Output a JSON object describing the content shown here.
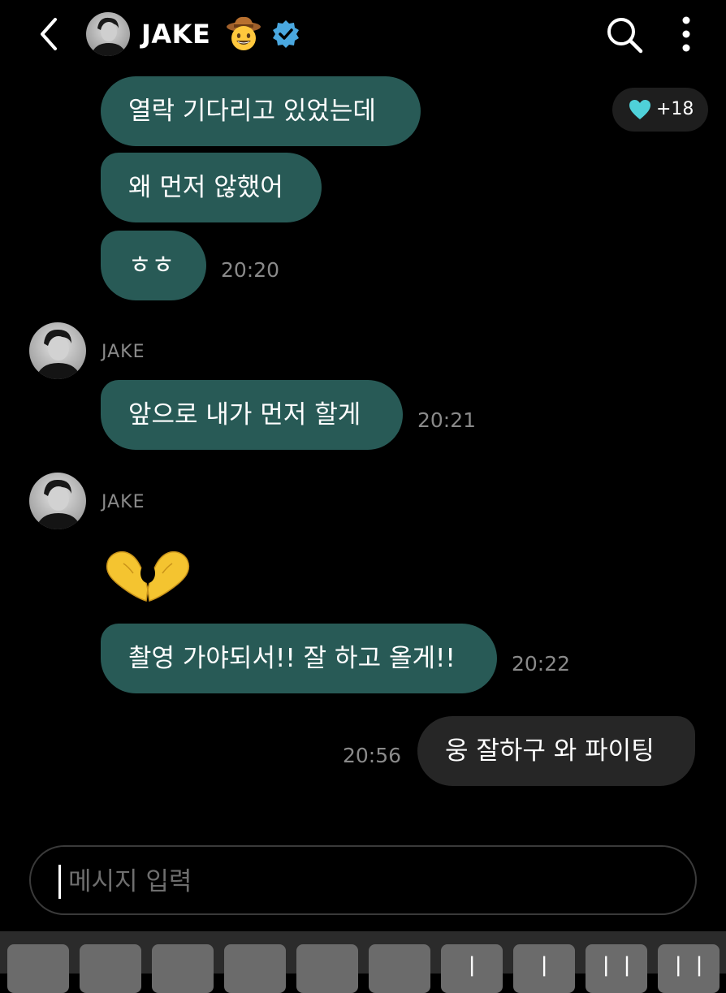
{
  "header": {
    "name": "JAKE",
    "back_icon": "chevron-left-icon",
    "badge_emoji_icon": "cowboy-hat-face-icon",
    "verified_icon": "verified-badge-icon",
    "search_icon": "search-icon",
    "more_icon": "more-vertical-icon"
  },
  "reaction": {
    "icon": "heart-icon",
    "count": "+18",
    "color": "#4fd1d9"
  },
  "messages": [
    {
      "sender": "",
      "text": "열락 기다리고 있었는데",
      "time": ""
    },
    {
      "sender": "",
      "text": "왜 먼저 않했어",
      "time": ""
    },
    {
      "sender": "",
      "text": "ㅎㅎ",
      "time": "20:20"
    },
    {
      "sender": "JAKE",
      "text": "앞으로 내가 먼저 할게",
      "time": "20:21"
    },
    {
      "sender": "JAKE",
      "emoji": "heart-hands-icon",
      "text": "촬영 가야되서!! 잘 하고 올게!!",
      "time": "20:22"
    }
  ],
  "my_message": {
    "text": "웅 잘하구 와 파이팅",
    "time": "20:56"
  },
  "input": {
    "placeholder": "메시지 입력"
  },
  "keyboard": {
    "keys": [
      "",
      "",
      "",
      "",
      "",
      "",
      "ㅣ",
      "ㅣ",
      "ㅣㅣ",
      "ㅣㅣ"
    ]
  },
  "colors": {
    "background": "#000000",
    "artist_bubble": "#285a56",
    "fan_bubble": "#262626",
    "timestamp": "#8a8a8a",
    "verified": "#4aa8e0"
  }
}
